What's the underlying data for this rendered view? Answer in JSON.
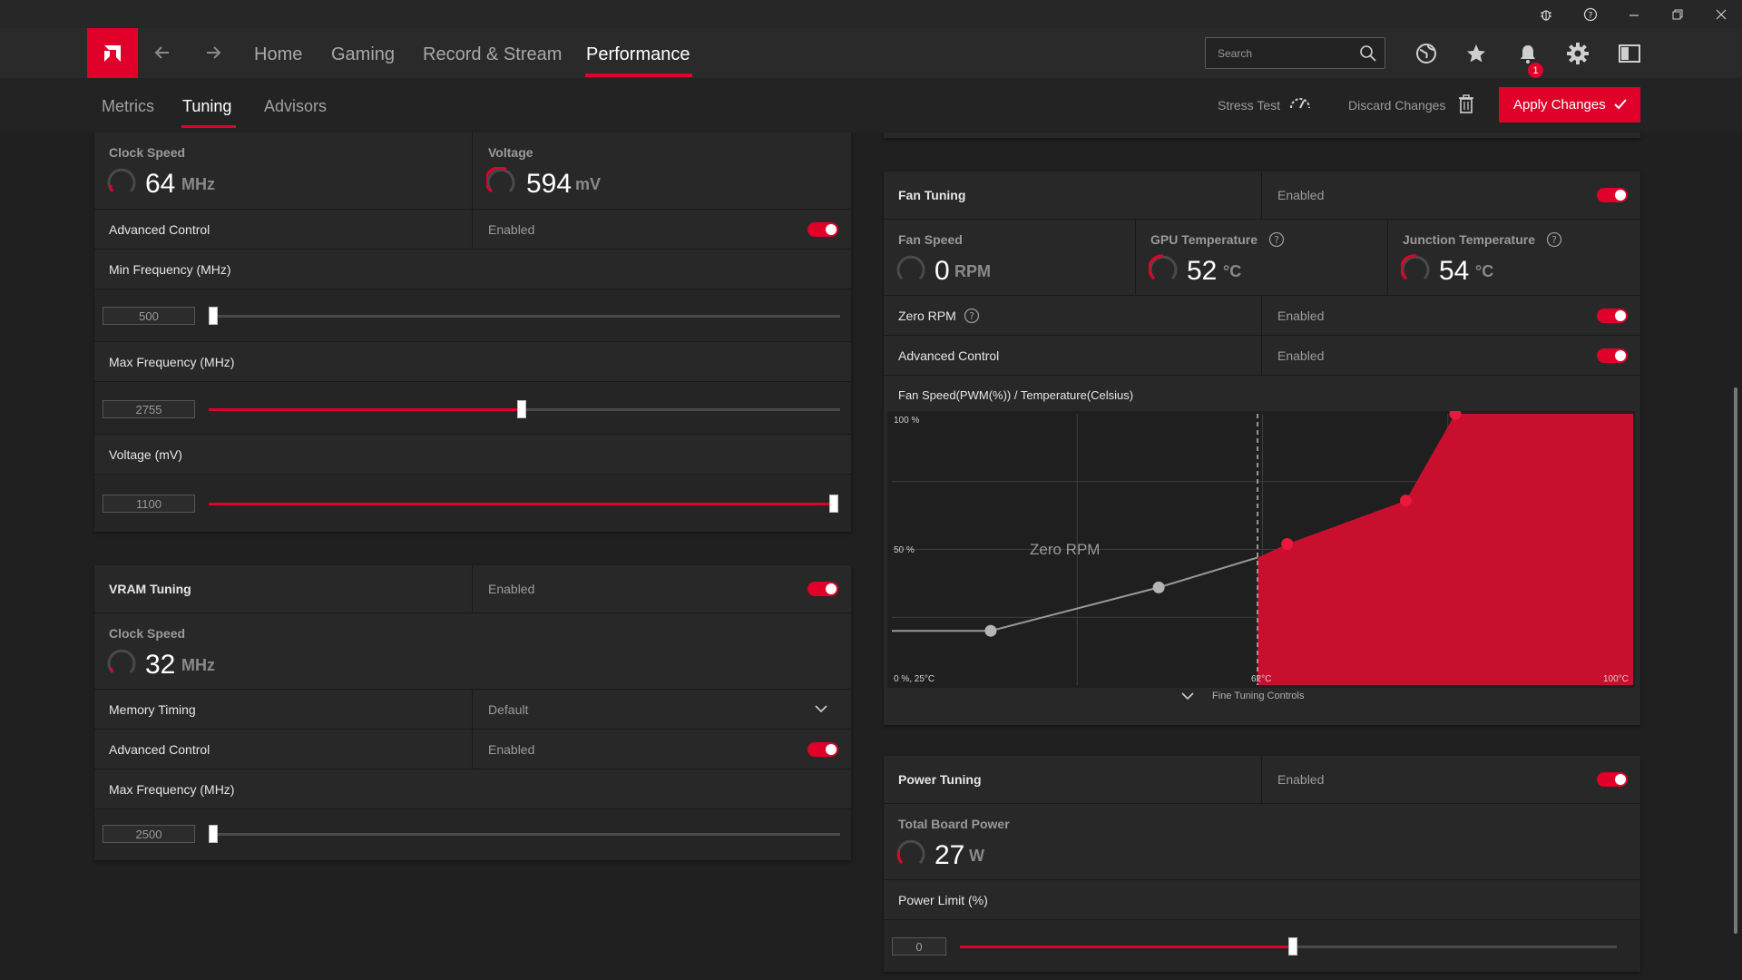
{
  "nav": {
    "items": [
      "Home",
      "Gaming",
      "Record & Stream",
      "Performance"
    ],
    "search_placeholder": "Search",
    "notification_count": "1"
  },
  "subnav": {
    "tabs": [
      "Metrics",
      "Tuning",
      "Advisors"
    ],
    "stress_test": "Stress Test",
    "discard": "Discard Changes",
    "apply": "Apply Changes"
  },
  "gpu": {
    "clock_label": "Clock Speed",
    "clock_value": "64",
    "clock_unit": "MHz",
    "voltage_label": "Voltage",
    "voltage_value": "594",
    "voltage_unit": "mV",
    "advanced_label": "Advanced Control",
    "advanced_value": "Enabled",
    "min_freq_label": "Min Frequency (MHz)",
    "min_freq_value": "500",
    "min_freq_fraction": 0.0,
    "max_freq_label": "Max Frequency (MHz)",
    "max_freq_value": "2755",
    "max_freq_fraction": 0.5,
    "volt_label": "Voltage (mV)",
    "volt_value": "1100",
    "volt_fraction": 1.0
  },
  "vram": {
    "title": "VRAM Tuning",
    "enabled": "Enabled",
    "clock_label": "Clock Speed",
    "clock_value": "32",
    "clock_unit": "MHz",
    "memory_timing_label": "Memory Timing",
    "memory_timing_value": "Default",
    "advanced_label": "Advanced Control",
    "advanced_value": "Enabled",
    "max_freq_label": "Max Frequency (MHz)",
    "max_freq_value": "2500",
    "max_freq_fraction": 0.0
  },
  "fan": {
    "title": "Fan Tuning",
    "enabled": "Enabled",
    "speed_label": "Fan Speed",
    "speed_value": "0",
    "speed_unit": "RPM",
    "gpu_temp_label": "GPU Temperature",
    "gpu_temp_value": "52",
    "gpu_temp_unit": "°C",
    "junction_label": "Junction Temperature",
    "junction_value": "54",
    "junction_unit": "°C",
    "zero_rpm_label": "Zero RPM",
    "zero_rpm_value": "Enabled",
    "advanced_label": "Advanced Control",
    "advanced_value": "Enabled",
    "curve_label": "Fan Speed(PWM(%)) / Temperature(Celsius)",
    "fine_tuning": "Fine Tuning Controls"
  },
  "power": {
    "title": "Power Tuning",
    "enabled": "Enabled",
    "tbp_label": "Total Board Power",
    "tbp_value": "27",
    "tbp_unit": "W",
    "limit_label": "Power Limit (%)",
    "limit_value": "0",
    "limit_fraction": 0.5
  },
  "chart_data": {
    "type": "area",
    "xlabel": "Temperature(Celsius)",
    "ylabel": "Fan Speed(PWM(%))",
    "xlim": [
      25,
      100
    ],
    "ylim": [
      0,
      100
    ],
    "tick_labels": {
      "top_left": "100 %",
      "mid_left": "50 %",
      "origin": "0 %, 25°C",
      "zero_rpm_x": "62°C",
      "right": "100°C"
    },
    "zero_rpm_threshold": 62,
    "zero_rpm_label": "Zero RPM",
    "series": [
      {
        "x": [
          25,
          35,
          52,
          62,
          65,
          77,
          82,
          100
        ],
        "y": [
          20,
          20,
          36,
          47,
          52,
          68,
          100,
          100
        ]
      }
    ],
    "points_inactive": [
      [
        35,
        20
      ],
      [
        52,
        36
      ]
    ],
    "points_active": [
      [
        65,
        52
      ],
      [
        77,
        68
      ],
      [
        82,
        100
      ]
    ],
    "grid": true
  }
}
